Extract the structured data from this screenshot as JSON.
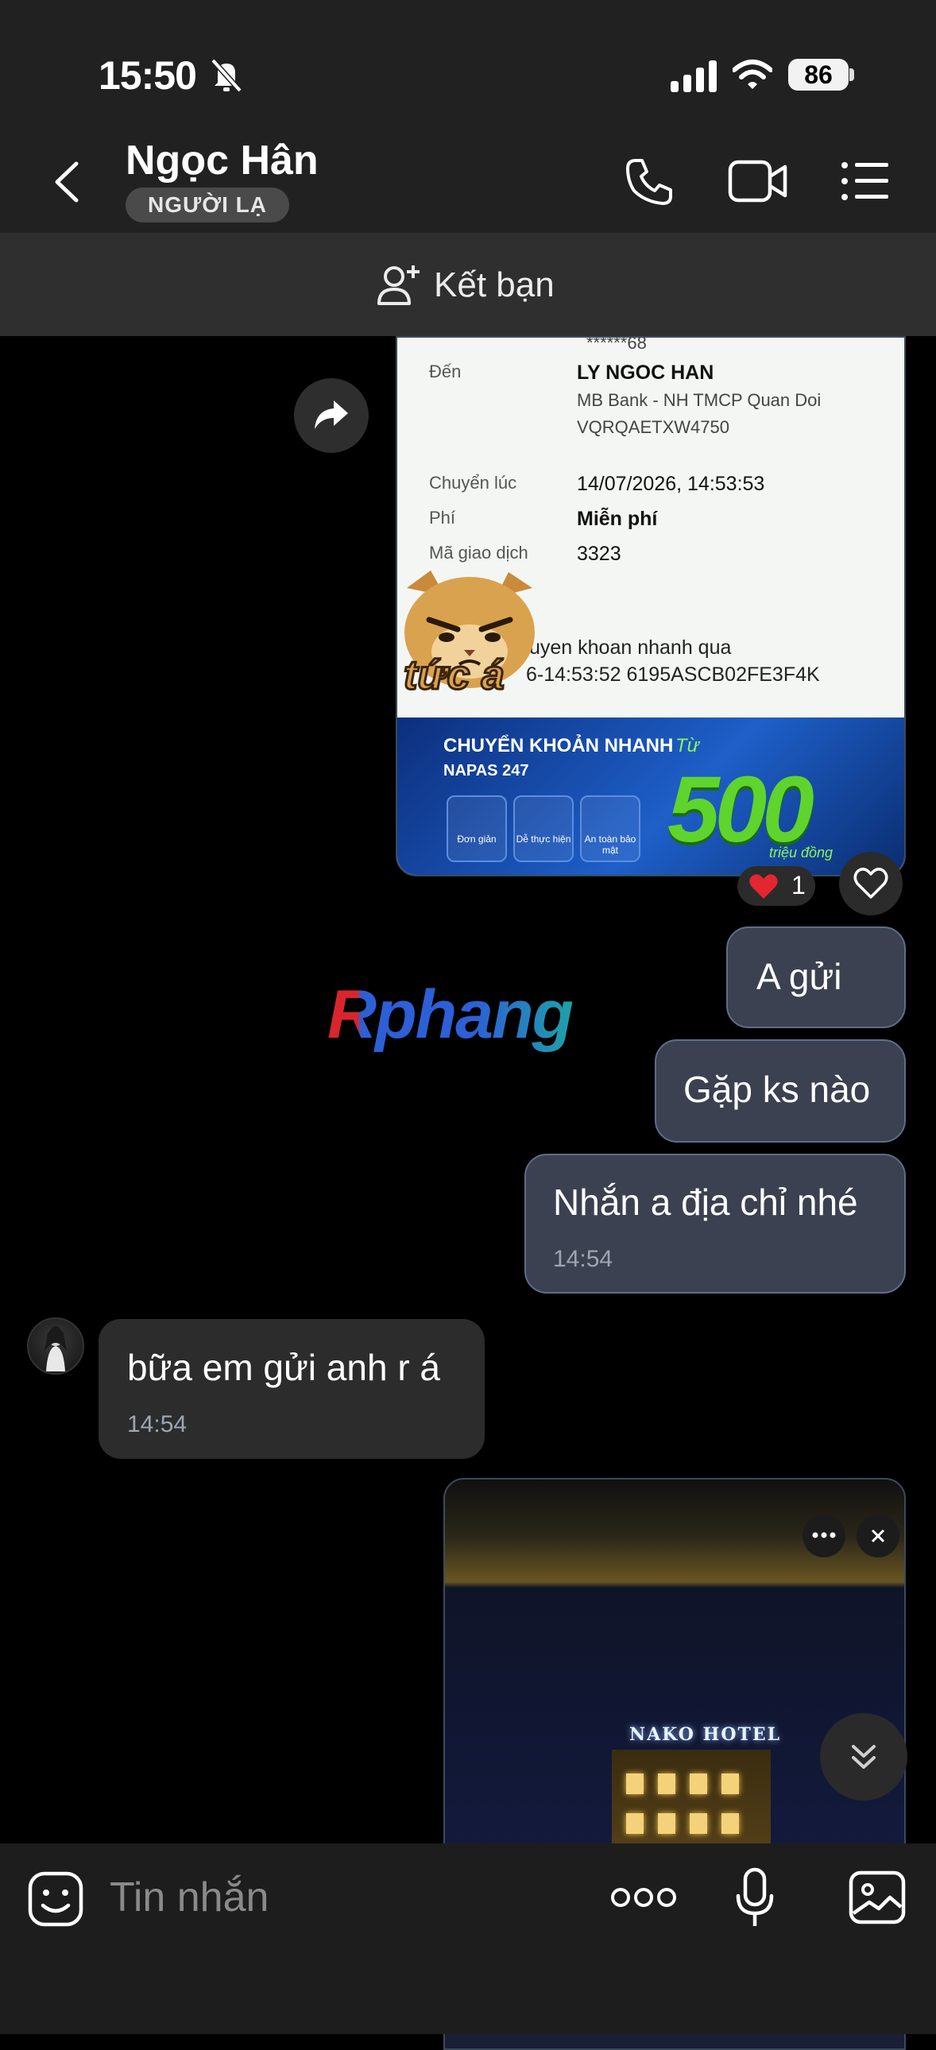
{
  "status_bar": {
    "time": "15:50",
    "battery": "86"
  },
  "header": {
    "contact_name": "Ngọc Hân",
    "badge": "NGƯỜI LẠ"
  },
  "friend_bar": {
    "label": "Kết bạn"
  },
  "receipt": {
    "masked_account": "******68",
    "to_label": "Đến",
    "to_name": "LY NGOC HAN",
    "to_bank": "MB Bank - NH TMCP Quan Doi",
    "to_account": "VQRQAETXW4750",
    "time_label": "Chuyển lúc",
    "time_value": "14/07/2026, 14:53:53",
    "fee_label": "Phí",
    "fee_value": "Miễn phí",
    "txn_label": "Mã giao dịch",
    "txn_value": "3323",
    "memo_line1": "uyen khoan nhanh qua",
    "memo_line2": "6-14:53:52 6195ASCB02FE3F4K",
    "banner_title": "CHUYỂN KHOẢN NHANH",
    "banner_sub": "NAPAS 247",
    "banner_from": "Từ",
    "banner_amount": "500",
    "banner_unit": "triệu đồng",
    "banner_features": [
      "Đơn giản",
      "Dễ thực hiện",
      "An toàn bảo mật"
    ]
  },
  "sticker": {
    "text": "tức á"
  },
  "reactions": {
    "heart_count": "1"
  },
  "watermark": {
    "text": "Rphang"
  },
  "messages": [
    {
      "text": "A gửi",
      "time": ""
    },
    {
      "text": "Gặp ks nào",
      "time": ""
    },
    {
      "text": "Nhắn a địa chỉ nhé",
      "time": "14:54"
    },
    {
      "text": "bữa em gửi anh r á",
      "time": "14:54"
    }
  ],
  "photo": {
    "sign": "NAKO HOTEL"
  },
  "composer": {
    "placeholder": "Tin nhắn"
  },
  "icons": {
    "back": "chevron-left-icon",
    "call": "phone-icon",
    "video": "video-icon",
    "menu": "list-icon",
    "add_friend": "add-user-icon",
    "forward": "share-icon",
    "like": "heart-icon",
    "emoji": "sticker-icon",
    "more": "more-icon",
    "mic": "microphone-icon",
    "gallery": "image-icon"
  }
}
